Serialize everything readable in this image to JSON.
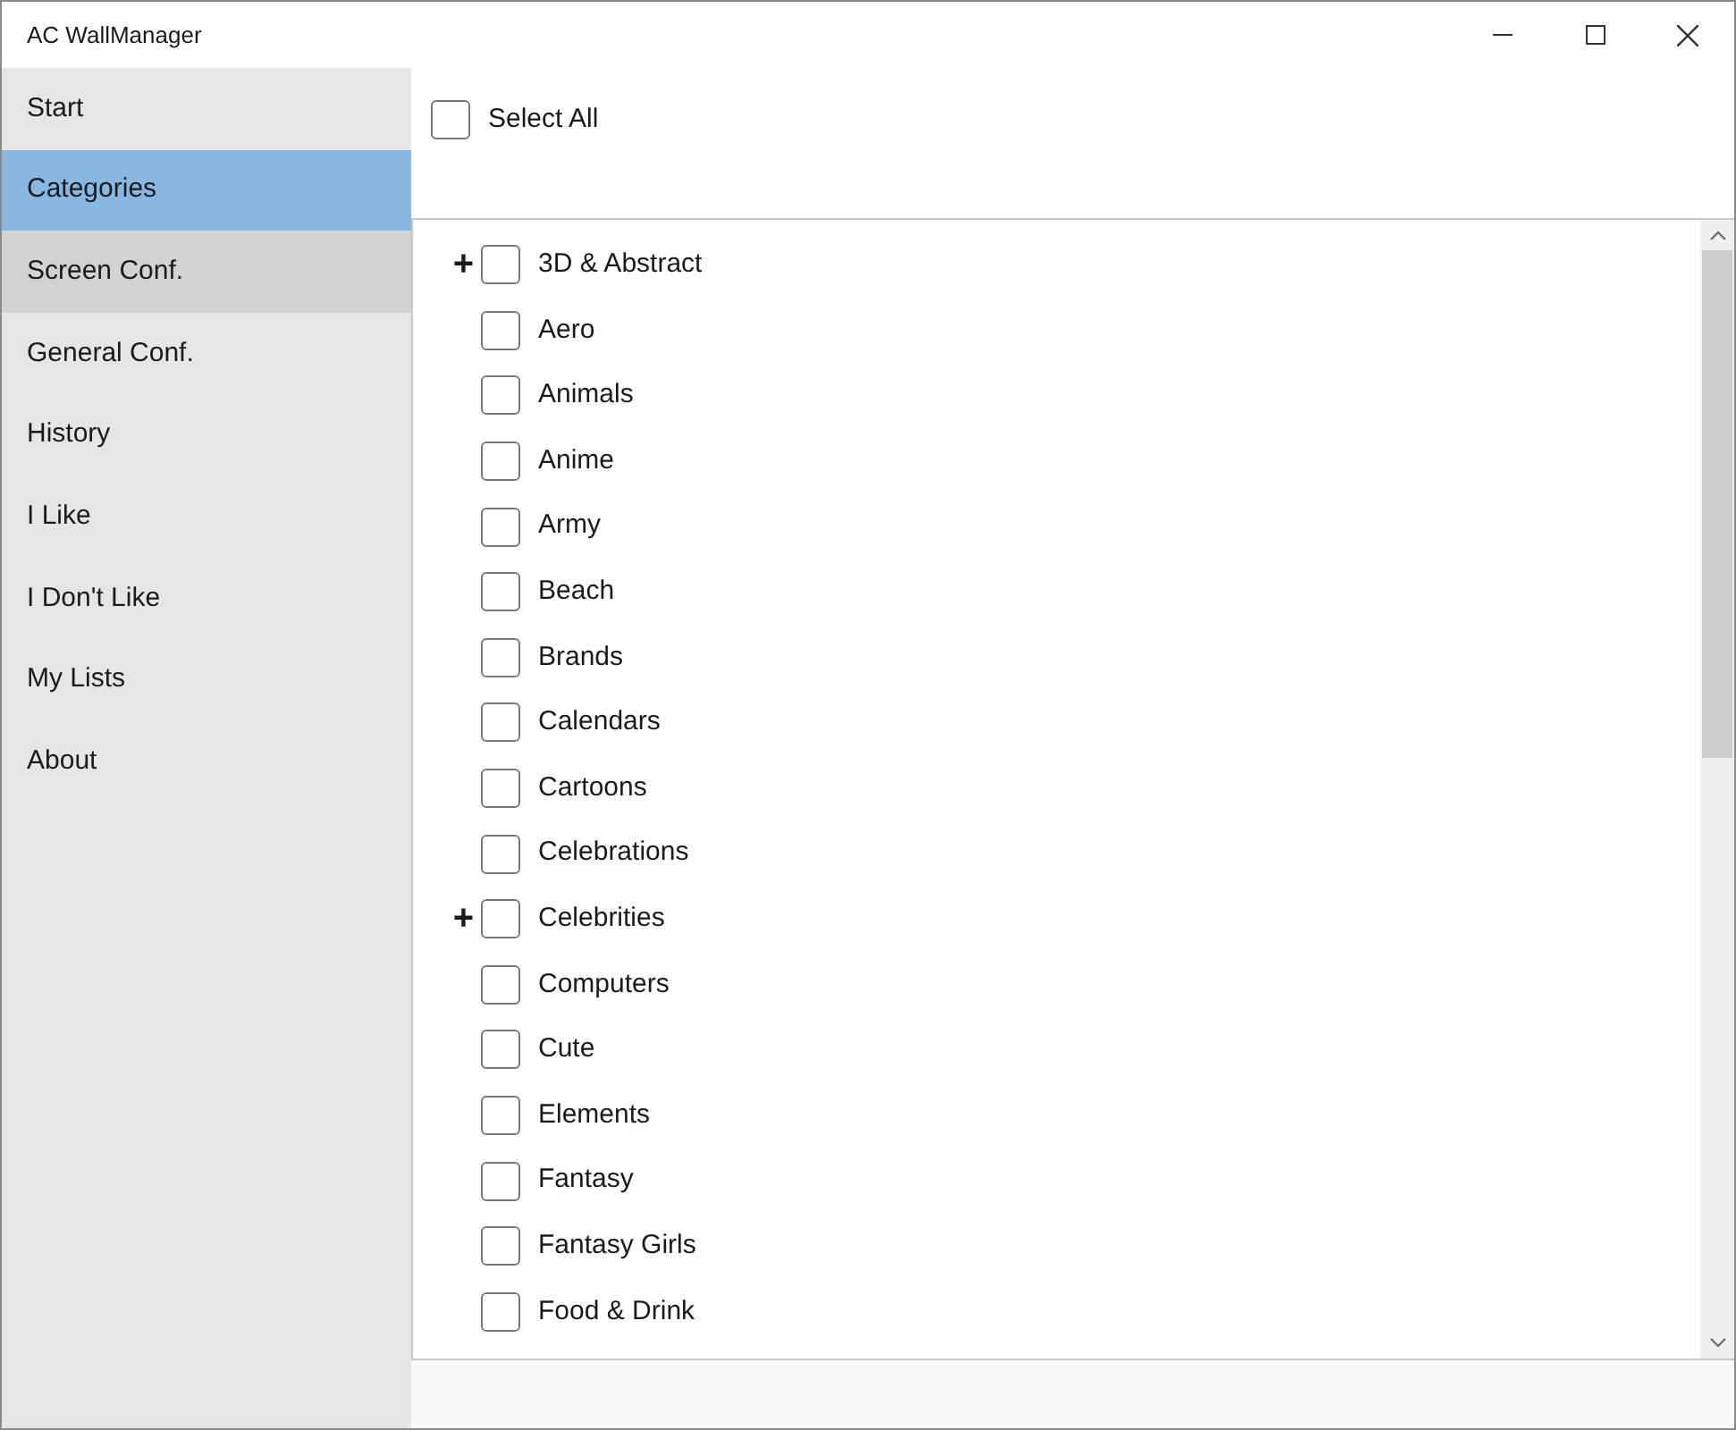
{
  "window": {
    "title": "AC WallManager"
  },
  "sidebar": {
    "items": [
      {
        "label": "Start",
        "selected": false,
        "hovered": false
      },
      {
        "label": "Categories",
        "selected": true,
        "hovered": false
      },
      {
        "label": "Screen Conf.",
        "selected": false,
        "hovered": true
      },
      {
        "label": "General Conf.",
        "selected": false,
        "hovered": false
      },
      {
        "label": "History",
        "selected": false,
        "hovered": false
      },
      {
        "label": "I Like",
        "selected": false,
        "hovered": false
      },
      {
        "label": "I Don't Like",
        "selected": false,
        "hovered": false
      },
      {
        "label": "My Lists",
        "selected": false,
        "hovered": false
      },
      {
        "label": "About",
        "selected": false,
        "hovered": false
      }
    ]
  },
  "select_all": {
    "label": "Select All",
    "checked": false
  },
  "categories": [
    {
      "label": "3D & Abstract",
      "checked": false,
      "expand_glyph": "+"
    },
    {
      "label": "Aero",
      "checked": false
    },
    {
      "label": "Animals",
      "checked": false
    },
    {
      "label": "Anime",
      "checked": false
    },
    {
      "label": "Army",
      "checked": false
    },
    {
      "label": "Beach",
      "checked": false
    },
    {
      "label": "Brands",
      "checked": false
    },
    {
      "label": "Calendars",
      "checked": false
    },
    {
      "label": "Cartoons",
      "checked": false
    },
    {
      "label": "Celebrations",
      "checked": false
    },
    {
      "label": "Celebrities",
      "checked": false,
      "expand_glyph": "+"
    },
    {
      "label": "Computers",
      "checked": false
    },
    {
      "label": "Cute",
      "checked": false
    },
    {
      "label": "Elements",
      "checked": false
    },
    {
      "label": "Fantasy",
      "checked": false
    },
    {
      "label": "Fantasy Girls",
      "checked": false
    },
    {
      "label": "Food & Drink",
      "checked": false
    }
  ]
}
